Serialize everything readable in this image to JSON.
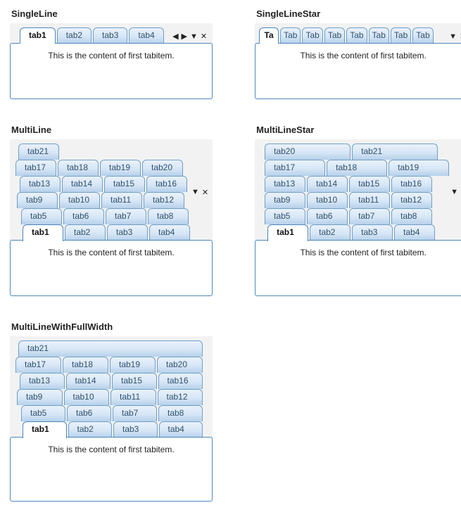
{
  "content_text": "This is the content of first tabitem.",
  "panels": {
    "singleLine": {
      "title": "SingleLine",
      "tabs": [
        "tab1",
        "tab2",
        "tab3",
        "tab4"
      ],
      "selected": 0
    },
    "singleLineStar": {
      "title": "SingleLineStar",
      "tabs": [
        "Ta",
        "Tab",
        "Tab",
        "Tab",
        "Tab",
        "Tab",
        "Tab",
        "Tab"
      ],
      "selected": 0
    },
    "multiLine": {
      "title": "MultiLine",
      "rows": [
        [
          "tab21"
        ],
        [
          "tab17",
          "tab18",
          "tab19",
          "tab20"
        ],
        [
          "tab13",
          "tab14",
          "tab15",
          "tab16"
        ],
        [
          "tab9",
          "tab10",
          "tab11",
          "tab12"
        ],
        [
          "tab5",
          "tab6",
          "tab7",
          "tab8"
        ],
        [
          "tab1",
          "tab2",
          "tab3",
          "tab4"
        ]
      ],
      "selected": "tab1"
    },
    "multiLineStar": {
      "title": "MultiLineStar",
      "rows": [
        [
          "tab20",
          "tab21"
        ],
        [
          "tab17",
          "tab18",
          "tab19"
        ],
        [
          "tab13",
          "tab14",
          "tab15",
          "tab16"
        ],
        [
          "tab9",
          "tab10",
          "tab11",
          "tab12"
        ],
        [
          "tab5",
          "tab6",
          "tab7",
          "tab8"
        ],
        [
          "tab1",
          "tab2",
          "tab3",
          "tab4"
        ]
      ],
      "selected": "tab1"
    },
    "multiLineFull": {
      "title": "MultiLineWithFullWidth",
      "rows": [
        [
          "tab21"
        ],
        [
          "tab17",
          "tab18",
          "tab19",
          "tab20"
        ],
        [
          "tab13",
          "tab14",
          "tab15",
          "tab16"
        ],
        [
          "tab9",
          "tab10",
          "tab11",
          "tab12"
        ],
        [
          "tab5",
          "tab6",
          "tab7",
          "tab8"
        ],
        [
          "tab1",
          "tab2",
          "tab3",
          "tab4"
        ]
      ],
      "selected": "tab1"
    }
  },
  "glyphs": {
    "left": "◀",
    "right": "▶",
    "dropdown": "▼",
    "close": "✕"
  }
}
